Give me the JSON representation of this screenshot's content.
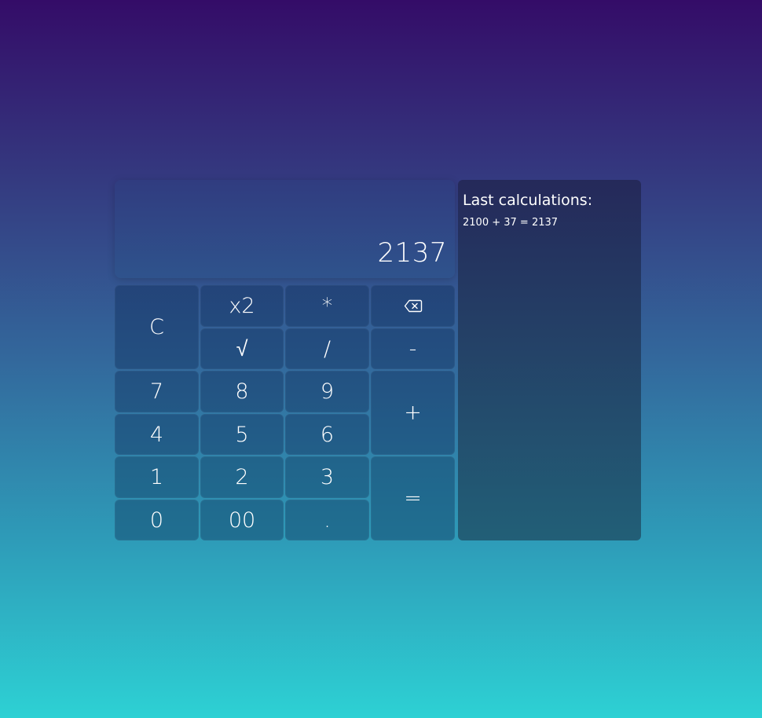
{
  "display": {
    "value": "2137"
  },
  "keys": {
    "clear": "C",
    "square": "x2",
    "multiply": "*",
    "backspace_icon": "backspace-icon",
    "sqrt": "√",
    "divide": "/",
    "minus": "-",
    "seven": "7",
    "eight": "8",
    "nine": "9",
    "plus": "+",
    "four": "4",
    "five": "5",
    "six": "6",
    "one": "1",
    "two": "2",
    "three": "3",
    "equals": "=",
    "zero": "0",
    "double_zero": "00",
    "dot": "."
  },
  "history": {
    "title": "Last calculations:",
    "items": [
      "2100 + 37 = 2137"
    ]
  },
  "colors": {
    "background_top": "#340c68",
    "background_bottom": "#2dd1d4",
    "text": "#ffffff"
  }
}
